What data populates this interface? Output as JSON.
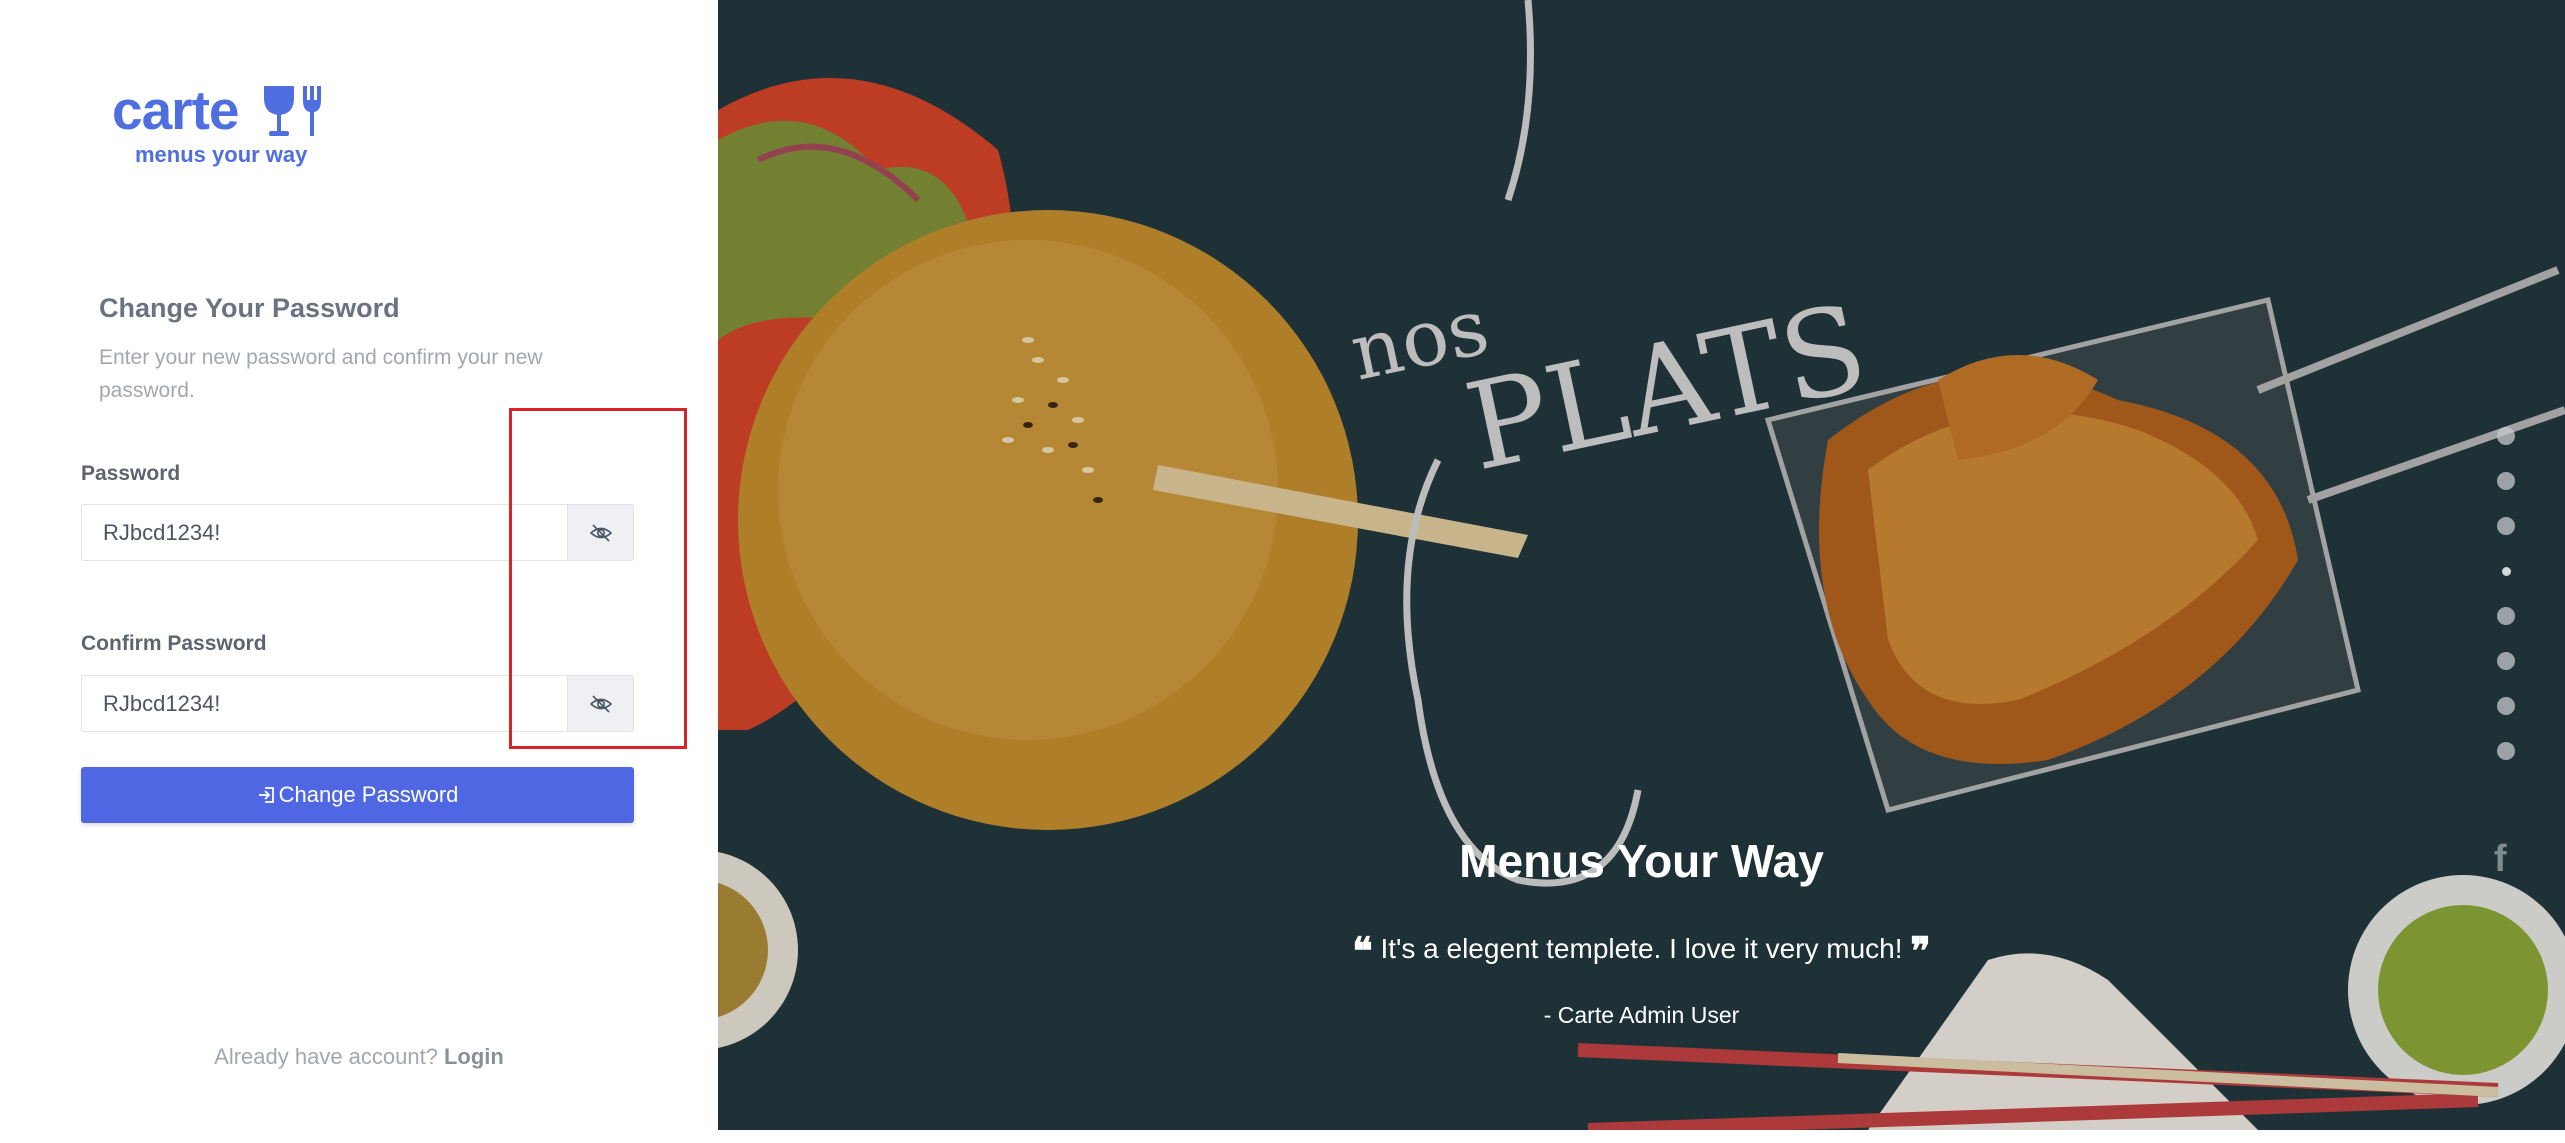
{
  "brand": {
    "name": "carte",
    "tagline": "menus your way",
    "icon": "wine-glass-fork-icon",
    "color": "#4f6ee0"
  },
  "form": {
    "title": "Change Your Password",
    "subtitle": "Enter your new password and confirm your new password.",
    "password": {
      "label": "Password",
      "value": "RJbcd1234!",
      "toggle_icon": "eye-slash-icon"
    },
    "confirm_password": {
      "label": "Confirm Password",
      "value": "RJbcd1234!",
      "toggle_icon": "eye-slash-icon"
    },
    "submit": {
      "label": "Change Password",
      "icon": "sign-in-icon",
      "color": "#4f67e2"
    }
  },
  "footer": {
    "prompt": "Already have account?",
    "link": "Login"
  },
  "hero": {
    "title": "Menus Your Way",
    "quote": "It's a elegent templete. I love it very much!",
    "author": "- Carte Admin User",
    "background_color": "#23383f",
    "slider_dots": 8,
    "active_dot": 4,
    "social_icon": "facebook-icon"
  },
  "annotation": {
    "color": "#d9232a"
  }
}
